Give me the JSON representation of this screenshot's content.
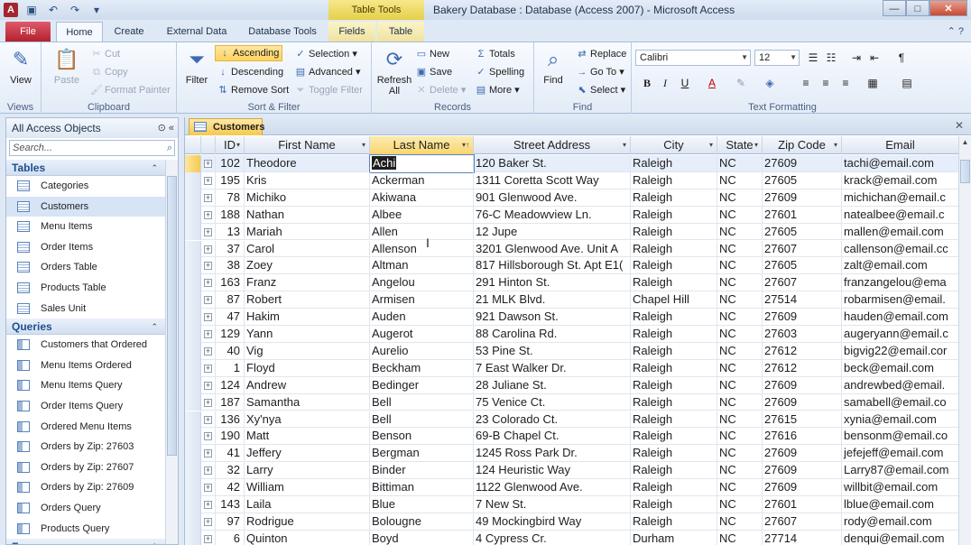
{
  "title_bar": {
    "app_logo": "A",
    "context_tab_header": "Table Tools",
    "window_title": "Bakery Database : Database (Access 2007)  -  Microsoft Access"
  },
  "ribbon_tabs": [
    {
      "label": "File"
    },
    {
      "label": "Home"
    },
    {
      "label": "Create"
    },
    {
      "label": "External Data"
    },
    {
      "label": "Database Tools"
    },
    {
      "label": "Fields"
    },
    {
      "label": "Table"
    }
  ],
  "ribbon": {
    "views": {
      "view_label": "View",
      "group_label": "Views"
    },
    "clipboard": {
      "paste": "Paste",
      "cut": "Cut",
      "copy": "Copy",
      "format_painter": "Format Painter",
      "group_label": "Clipboard"
    },
    "sort_filter": {
      "filter": "Filter",
      "ascending": "Ascending",
      "descending": "Descending",
      "remove_sort": "Remove Sort",
      "selection": "Selection",
      "advanced": "Advanced",
      "toggle_filter": "Toggle Filter",
      "group_label": "Sort & Filter"
    },
    "records": {
      "refresh": "Refresh All",
      "new": "New",
      "save": "Save",
      "delete": "Delete",
      "totals": "Totals",
      "spelling": "Spelling",
      "more": "More",
      "group_label": "Records"
    },
    "find": {
      "find": "Find",
      "replace": "Replace",
      "goto": "Go To",
      "select": "Select",
      "group_label": "Find"
    },
    "text_formatting": {
      "font": "Calibri",
      "size": "12",
      "group_label": "Text Formatting"
    }
  },
  "nav": {
    "header": "All Access Objects",
    "search_placeholder": "Search...",
    "groups": [
      {
        "label": "Tables",
        "items": [
          "Categories",
          "Customers",
          "Menu Items",
          "Order Items",
          "Orders Table",
          "Products Table",
          "Sales Unit"
        ]
      },
      {
        "label": "Queries",
        "items": [
          "Customers that Ordered",
          "Menu Items Ordered",
          "Menu Items Query",
          "Order Items Query",
          "Ordered Menu Items",
          "Orders by Zip: 27603",
          "Orders by Zip: 27607",
          "Orders by Zip: 27609",
          "Orders Query",
          "Products Query"
        ]
      },
      {
        "label": "Forms",
        "items": []
      }
    ]
  },
  "document": {
    "tab_label": "Customers",
    "columns": [
      "ID",
      "First Name",
      "Last Name",
      "Street Address",
      "City",
      "State",
      "Zip Code",
      "Email"
    ],
    "rows": [
      [
        "102",
        "Theodore",
        "Achi",
        "120 Baker St.",
        "Raleigh",
        "NC",
        "27609",
        "tachi@email.com"
      ],
      [
        "195",
        "Kris",
        "Ackerman",
        "1311 Coretta Scott Way",
        "Raleigh",
        "NC",
        "27605",
        "krack@email.com"
      ],
      [
        "78",
        "Michiko",
        "Akiwana",
        "901 Glenwood Ave.",
        "Raleigh",
        "NC",
        "27609",
        "michichan@email.c"
      ],
      [
        "188",
        "Nathan",
        "Albee",
        "76-C Meadowview Ln.",
        "Raleigh",
        "NC",
        "27601",
        "natealbee@email.c"
      ],
      [
        "13",
        "Mariah",
        "Allen",
        "12 Jupe",
        "Raleigh",
        "NC",
        "27605",
        "mallen@email.com"
      ],
      [
        "37",
        "Carol",
        "Allenson",
        "3201 Glenwood Ave. Unit A",
        "Raleigh",
        "NC",
        "27607",
        "callenson@email.cc"
      ],
      [
        "38",
        "Zoey",
        "Altman",
        "817 Hillsborough St. Apt E1(",
        "Raleigh",
        "NC",
        "27605",
        "zalt@email.com"
      ],
      [
        "163",
        "Franz",
        "Angelou",
        "291 Hinton St.",
        "Raleigh",
        "NC",
        "27607",
        "franzangelou@ema"
      ],
      [
        "87",
        "Robert",
        "Armisen",
        "21 MLK Blvd.",
        "Chapel Hill",
        "NC",
        "27514",
        "robarmisen@email."
      ],
      [
        "47",
        "Hakim",
        "Auden",
        "921 Dawson St.",
        "Raleigh",
        "NC",
        "27609",
        "hauden@email.com"
      ],
      [
        "129",
        "Yann",
        "Augerot",
        "88 Carolina Rd.",
        "Raleigh",
        "NC",
        "27603",
        "augeryann@email.c"
      ],
      [
        "40",
        "Vig",
        "Aurelio",
        "53 Pine St.",
        "Raleigh",
        "NC",
        "27612",
        "bigvig22@email.cor"
      ],
      [
        "1",
        "Floyd",
        "Beckham",
        "7 East Walker Dr.",
        "Raleigh",
        "NC",
        "27612",
        "beck@email.com"
      ],
      [
        "124",
        "Andrew",
        "Bedinger",
        "28 Juliane St.",
        "Raleigh",
        "NC",
        "27609",
        "andrewbed@email."
      ],
      [
        "187",
        "Samantha",
        "Bell",
        "75 Venice Ct.",
        "Raleigh",
        "NC",
        "27609",
        "samabell@email.co"
      ],
      [
        "136",
        "Xy'nya",
        "Bell",
        "23 Colorado Ct.",
        "Raleigh",
        "NC",
        "27615",
        "xynia@email.com"
      ],
      [
        "190",
        "Matt",
        "Benson",
        "69-B Chapel Ct.",
        "Raleigh",
        "NC",
        "27616",
        "bensonm@email.co"
      ],
      [
        "41",
        "Jeffery",
        "Bergman",
        "1245 Ross Park Dr.",
        "Raleigh",
        "NC",
        "27609",
        "jefejeff@email.com"
      ],
      [
        "32",
        "Larry",
        "Binder",
        "124 Heuristic Way",
        "Raleigh",
        "NC",
        "27609",
        "Larry87@email.com"
      ],
      [
        "42",
        "William",
        "Bittiman",
        "1122 Glenwood Ave.",
        "Raleigh",
        "NC",
        "27609",
        "willbit@email.com"
      ],
      [
        "143",
        "Laila",
        "Blue",
        "7 New St.",
        "Raleigh",
        "NC",
        "27601",
        "lblue@email.com"
      ],
      [
        "97",
        "Rodrigue",
        "Bolougne",
        "49 Mockingbird Way",
        "Raleigh",
        "NC",
        "27607",
        "rody@email.com"
      ],
      [
        "6",
        "Quinton",
        "Boyd",
        "4 Cypress Cr.",
        "Durham",
        "NC",
        "27714",
        "denqui@email.com"
      ]
    ]
  },
  "colors": {
    "accent": "#f6c94f",
    "file_tab": "#b3202f",
    "ribbon_bg": "#e2ebf7"
  }
}
